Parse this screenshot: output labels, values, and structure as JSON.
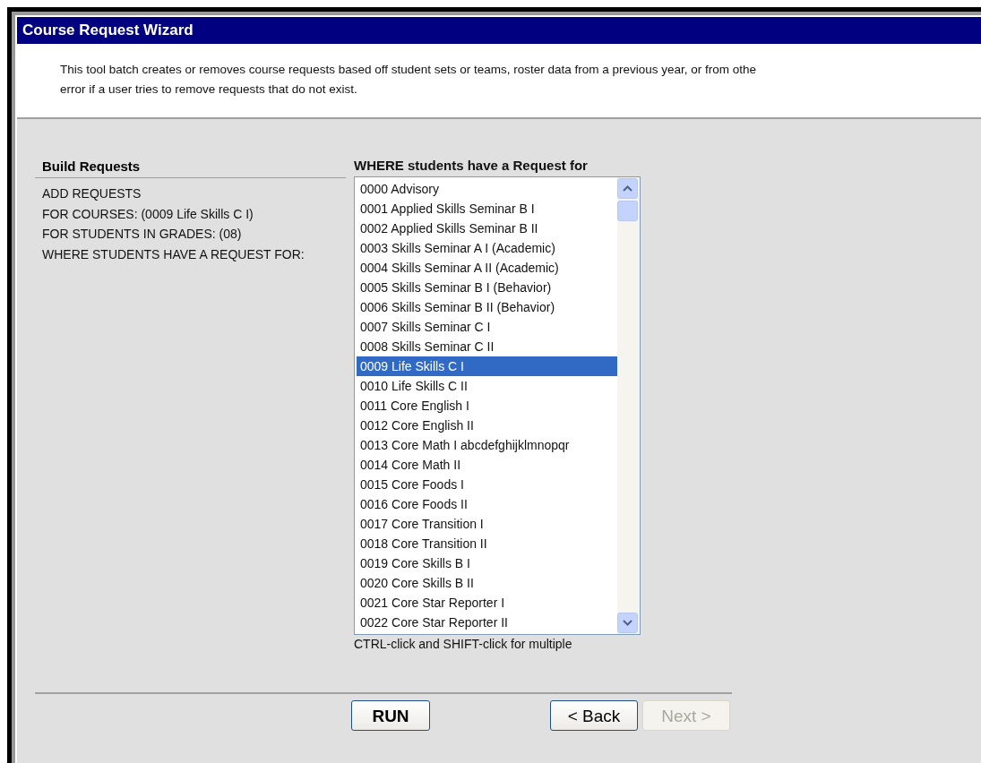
{
  "window": {
    "title": "Course Request Wizard"
  },
  "description": [
    "This tool batch creates or removes course requests based off student sets or teams, roster data from a previous year, or from othe",
    "error if a user tries to remove requests that do not exist."
  ],
  "build_requests": {
    "heading": "Build Requests",
    "lines": [
      "ADD REQUESTS",
      "FOR COURSES: (0009 Life Skills C I)",
      "FOR STUDENTS IN GRADES: (08)",
      "WHERE STUDENTS HAVE A REQUEST FOR:"
    ]
  },
  "course_list": {
    "heading": "WHERE students have a Request for",
    "hint": "CTRL-click and SHIFT-click for multiple",
    "items": [
      {
        "label": "0000 Advisory",
        "selected": false
      },
      {
        "label": "0001 Applied Skills Seminar B I",
        "selected": false
      },
      {
        "label": "0002 Applied Skills Seminar B II",
        "selected": false
      },
      {
        "label": "0003 Skills Seminar A I (Academic)",
        "selected": false
      },
      {
        "label": "0004 Skills Seminar A II (Academic)",
        "selected": false
      },
      {
        "label": "0005 Skills Seminar B I (Behavior)",
        "selected": false
      },
      {
        "label": "0006 Skills Seminar B II (Behavior)",
        "selected": false
      },
      {
        "label": "0007 Skills Seminar C I",
        "selected": false
      },
      {
        "label": "0008 Skills Seminar C II",
        "selected": false
      },
      {
        "label": "0009 Life Skills C I",
        "selected": true
      },
      {
        "label": "0010 Life Skills C II",
        "selected": false
      },
      {
        "label": "0011 Core English I",
        "selected": false
      },
      {
        "label": "0012 Core English II",
        "selected": false
      },
      {
        "label": "0013 Core Math I abcdefghijklmnopqr",
        "selected": false
      },
      {
        "label": "0014 Core Math II",
        "selected": false
      },
      {
        "label": "0015 Core Foods I",
        "selected": false
      },
      {
        "label": "0016 Core Foods II",
        "selected": false
      },
      {
        "label": "0017 Core Transition I",
        "selected": false
      },
      {
        "label": "0018 Core Transition II",
        "selected": false
      },
      {
        "label": "0019 Core Skills B I",
        "selected": false
      },
      {
        "label": "0020 Core Skills B II",
        "selected": false
      },
      {
        "label": "0021 Core Star Reporter I",
        "selected": false
      },
      {
        "label": "0022 Core Star Reporter II",
        "selected": false
      }
    ]
  },
  "buttons": [
    {
      "label": "RUN",
      "kind": "run",
      "disabled": false
    },
    {
      "label": "< Back",
      "kind": "nav",
      "disabled": false
    },
    {
      "label": "Next >",
      "kind": "nav",
      "disabled": true
    }
  ]
}
